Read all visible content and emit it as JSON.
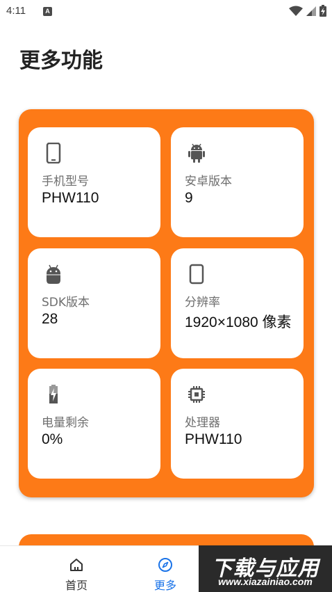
{
  "status_bar": {
    "time": "4:11",
    "notification_letter": "A"
  },
  "page": {
    "title": "更多功能"
  },
  "cards": [
    {
      "icon": "phone-icon",
      "label": "手机型号",
      "value": "PHW110"
    },
    {
      "icon": "android-icon",
      "label": "安卓版本",
      "value": "9"
    },
    {
      "icon": "android-head-icon",
      "label": "SDK版本",
      "value": "28"
    },
    {
      "icon": "screen-icon",
      "label": "分辨率",
      "value": "1920×1080 像素"
    },
    {
      "icon": "battery-charging-icon",
      "label": "电量剩余",
      "value": "0%"
    },
    {
      "icon": "chip-icon",
      "label": "处理器",
      "value": "PHW110"
    }
  ],
  "bottom_nav": {
    "home_label": "首页",
    "more_label": "更多",
    "active": "more"
  },
  "watermark": {
    "main": "下载与应用",
    "url": "www.xiazainiao.com"
  },
  "colors": {
    "accent": "#fd7a17",
    "active_nav": "#1a73e8"
  }
}
